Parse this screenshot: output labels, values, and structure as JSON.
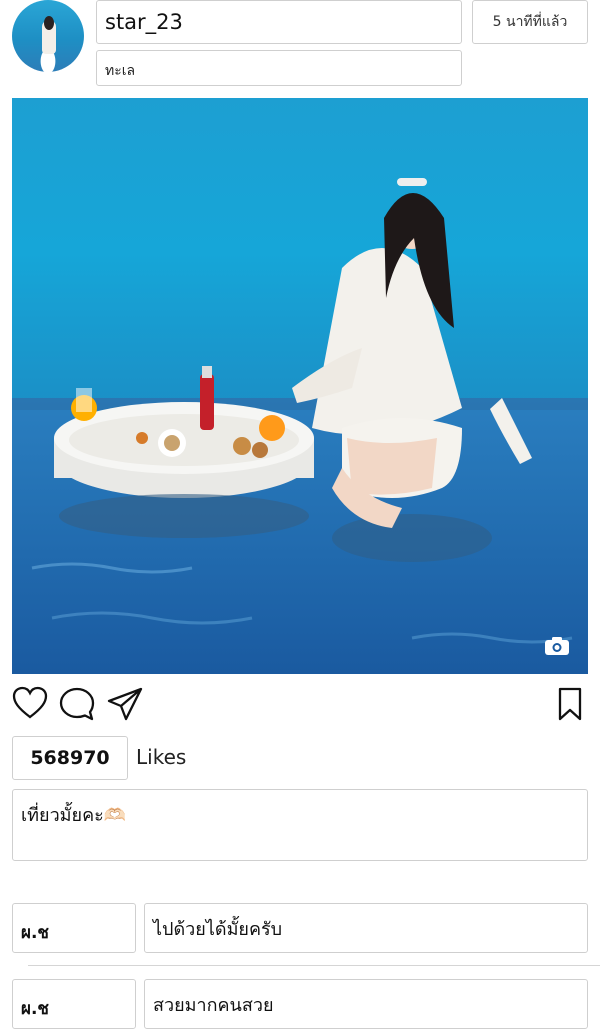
{
  "post": {
    "username": "star_23",
    "time": "5 นาทีที่แล้ว",
    "location": "ทะเล",
    "likes_count": "568970",
    "likes_label": "Likes",
    "caption": "เที่ยวมั้ยคะ🫶🏻"
  },
  "comments": [
    {
      "user": "ผ.ช",
      "text": "ไปด้วยได้มั้ยครับ"
    },
    {
      "user": "ผ.ช",
      "text": "สวยมากคนสวย"
    }
  ],
  "icons": {
    "like": "heart-icon",
    "comment": "comment-bubble-icon",
    "share": "send-icon",
    "save": "bookmark-icon",
    "photo_type": "camera-icon"
  },
  "colors": {
    "sea": "#1aa3d4",
    "pool": "#1f6fb0",
    "border": "#cfcfcf"
  }
}
